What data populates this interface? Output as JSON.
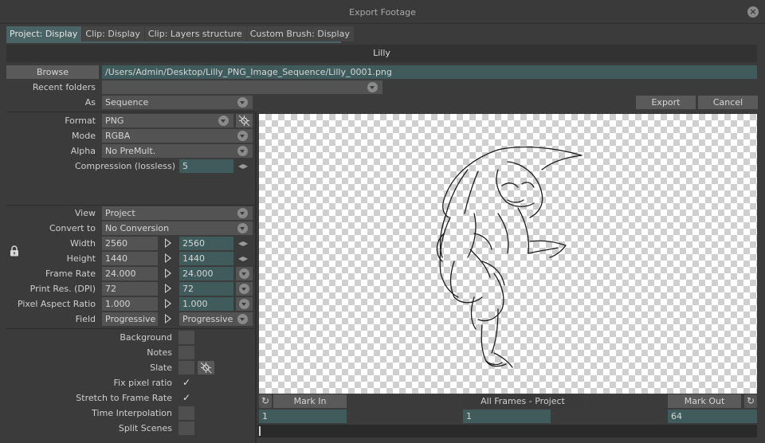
{
  "window": {
    "title": "Export Footage"
  },
  "tabs": [
    {
      "label": "Project: Display"
    },
    {
      "label": "Clip: Display"
    },
    {
      "label": "Clip: Layers structure"
    },
    {
      "label": "Custom Brush: Display"
    }
  ],
  "clip_name": "Lilly",
  "browse": {
    "label": "Browse",
    "path": "/Users/Admin/Desktop/Lilly_PNG_Image_Sequence/Lilly_0001.png"
  },
  "recent_folders": {
    "label": "Recent folders",
    "value": ""
  },
  "as": {
    "label": "As",
    "value": "Sequence"
  },
  "actions": {
    "export": "Export",
    "cancel": "Cancel"
  },
  "format_section": {
    "format": {
      "label": "Format",
      "value": "PNG"
    },
    "mode": {
      "label": "Mode",
      "value": "RGBA"
    },
    "alpha": {
      "label": "Alpha",
      "value": "No PreMult."
    },
    "compression": {
      "label": "Compression (lossless)",
      "value": "5"
    }
  },
  "view_section": {
    "view": {
      "label": "View",
      "value": "Project"
    },
    "convert_to": {
      "label": "Convert to",
      "value": "No Conversion"
    },
    "width": {
      "label": "Width",
      "source": "2560",
      "target": "2560"
    },
    "height": {
      "label": "Height",
      "source": "1440",
      "target": "1440"
    },
    "frame_rate": {
      "label": "Frame Rate",
      "source": "24.000",
      "target": "24.000"
    },
    "print_res": {
      "label": "Print Res. (DPI)",
      "source": "72",
      "target": "72"
    },
    "pixel_aspect": {
      "label": "Pixel Aspect Ratio",
      "source": "1.000",
      "target": "1.000"
    },
    "field": {
      "label": "Field",
      "source": "Progressive",
      "target": "Progressive"
    }
  },
  "options": {
    "background": {
      "label": "Background",
      "checked": false
    },
    "notes": {
      "label": "Notes",
      "checked": false
    },
    "slate": {
      "label": "Slate",
      "checked": false
    },
    "fix_pixel_ratio": {
      "label": "Fix pixel ratio",
      "checked": true
    },
    "stretch_to_frame_rate": {
      "label": "Stretch to Frame Rate",
      "checked": true
    },
    "time_interpolation": {
      "label": "Time Interpolation",
      "checked": false
    },
    "split_scenes": {
      "label": "Split Scenes",
      "checked": false
    }
  },
  "range": {
    "mark_in": {
      "label": "Mark In",
      "value": "1"
    },
    "all_frames": {
      "label": "All Frames - Project",
      "value": "1"
    },
    "mark_out": {
      "label": "Mark Out",
      "value": "64"
    }
  },
  "icons": {
    "close": "close-icon",
    "lock": "lock-icon",
    "refresh": "refresh-icon",
    "settings": "settings-icon"
  },
  "colors": {
    "accent_teal": "#3f5b5c",
    "active_tab": "#4a6466",
    "panel": "#3b3b3b"
  },
  "check_glyph": "✓"
}
